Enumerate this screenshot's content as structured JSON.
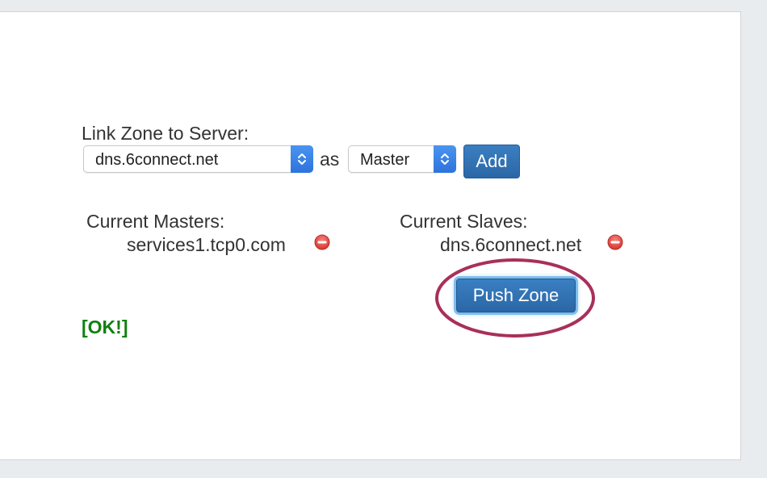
{
  "link_form": {
    "label": "Link Zone to Server:",
    "server_select": {
      "selected": "dns.6connect.net"
    },
    "as_text": "as",
    "role_select": {
      "selected": "Master"
    },
    "add_label": "Add"
  },
  "masters": {
    "heading": "Current Masters:",
    "items": [
      {
        "name": "services1.tcp0.com",
        "remove_icon": "minus-circle-icon"
      }
    ]
  },
  "slaves": {
    "heading": "Current Slaves:",
    "items": [
      {
        "name": "dns.6connect.net",
        "remove_icon": "minus-circle-icon"
      }
    ]
  },
  "push_zone_label": "Push Zone",
  "status": "[OK!]",
  "colors": {
    "primary_button": "#2f6fb0",
    "ok_status": "#118011",
    "remove_icon": "#e0443f",
    "highlight_ellipse": "#a8305a",
    "select_arrow": "#3a84e6"
  }
}
